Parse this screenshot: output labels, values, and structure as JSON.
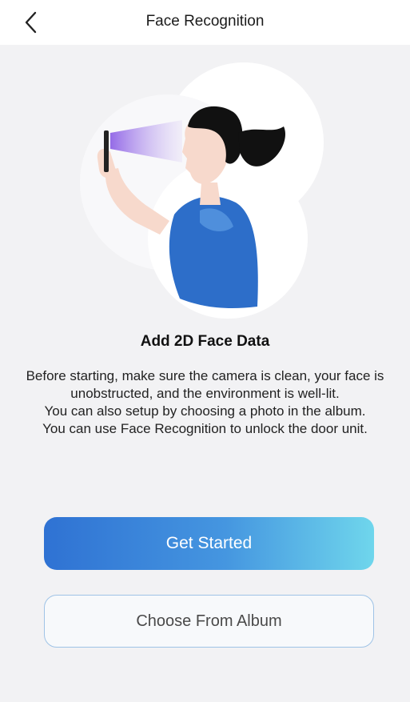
{
  "header": {
    "title": "Face Recognition",
    "back_icon": "chevron-left-icon"
  },
  "illustration": {
    "description_icon": "face-scan-illustration",
    "colors": {
      "circle": "#ffffff",
      "shirt": "#2d6ec9",
      "hair": "#111111",
      "skin": "#f7d9cc",
      "scan_beam": "#8f63e6"
    }
  },
  "content": {
    "heading": "Add 2D Face Data",
    "description_lines": [
      "Before starting, make sure the camera is clean, your face is unobstructed, and the environment is well-lit.",
      "You can also setup by choosing a photo in the album.",
      "You can use Face Recognition to unlock the door unit."
    ]
  },
  "actions": {
    "primary_label": "Get Started",
    "secondary_label": "Choose From Album",
    "primary_gradient": [
      "#2f72d3",
      "#6fd6ec"
    ]
  }
}
